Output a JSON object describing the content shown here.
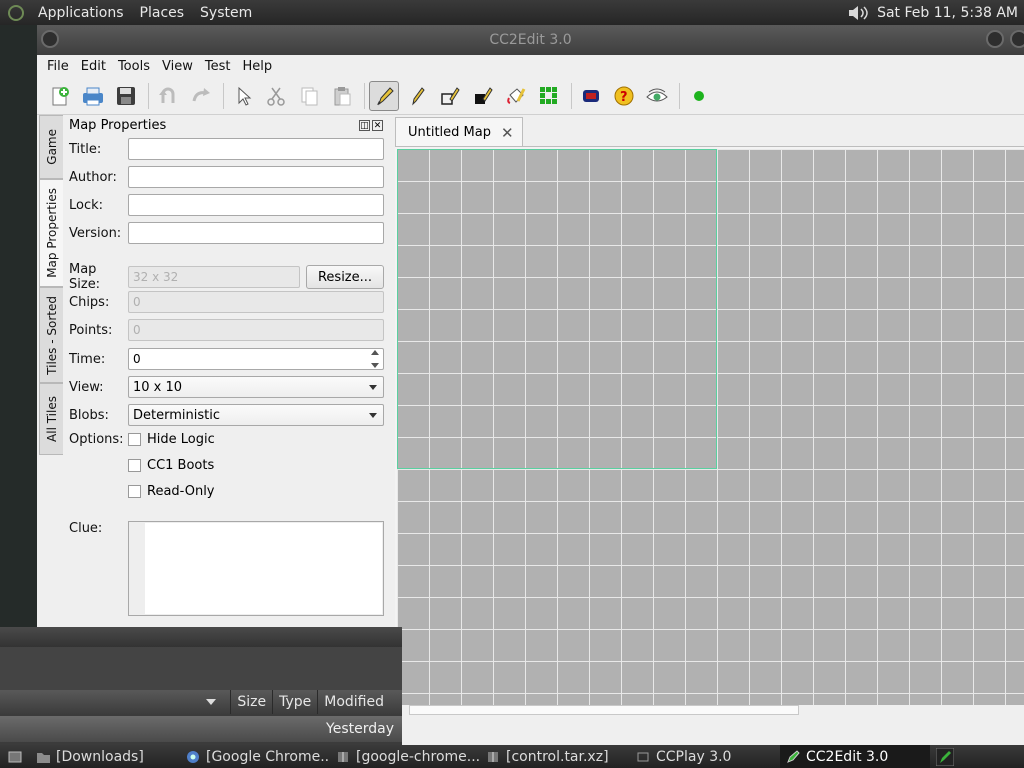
{
  "top_panel": {
    "menus": [
      "Applications",
      "Places",
      "System"
    ],
    "clock": "Sat Feb 11,  5:38 AM"
  },
  "window": {
    "title": "CC2Edit 3.0",
    "menubar": [
      "File",
      "Edit",
      "Tools",
      "View",
      "Test",
      "Help"
    ]
  },
  "side_tabs": [
    "Game",
    "Map Properties",
    "Tiles - Sorted",
    "All Tiles"
  ],
  "dock": {
    "title": "Map Properties",
    "title_label": "Title:",
    "title_value": "",
    "author_label": "Author:",
    "author_value": "",
    "lock_label": "Lock:",
    "lock_value": "",
    "version_label": "Version:",
    "version_value": "",
    "mapsize_label": "Map Size:",
    "mapsize_value": "32 x 32",
    "resize_label": "Resize...",
    "chips_label": "Chips:",
    "chips_value": "0",
    "points_label": "Points:",
    "points_value": "0",
    "time_label": "Time:",
    "time_value": "0",
    "view_label": "View:",
    "view_value": "10 x 10",
    "blobs_label": "Blobs:",
    "blobs_value": "Deterministic",
    "options_label": "Options:",
    "opt_hide_logic": "Hide Logic",
    "opt_cc1_boots": "CC1 Boots",
    "opt_read_only": "Read-Only",
    "clue_label": "Clue:"
  },
  "map_tab": {
    "label": "Untitled Map"
  },
  "file_manager": {
    "columns": [
      "Size",
      "Type",
      "Modified"
    ],
    "row_modified": "Yesterday"
  },
  "taskbar": {
    "items": [
      "[Downloads]",
      "[Google Chrome...",
      "[google-chrome...",
      "[control.tar.xz]",
      "CCPlay 3.0",
      "CC2Edit 3.0"
    ]
  },
  "colors": {
    "tile": "#b1b1b1",
    "view_rect": "#5ad0a0",
    "panel": "#2a2a2a"
  }
}
